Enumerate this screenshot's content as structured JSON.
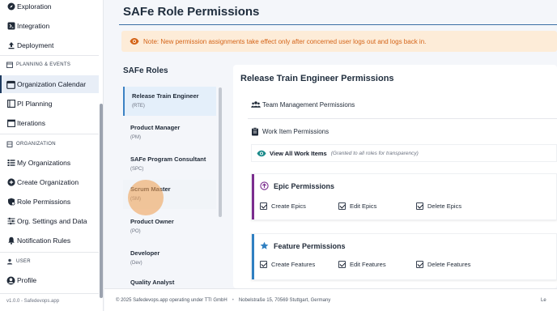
{
  "sidebar": {
    "items_top": [
      {
        "label": "Exploration",
        "icon": "compass-icon"
      },
      {
        "label": "Integration",
        "icon": "integration-icon"
      },
      {
        "label": "Deployment",
        "icon": "upload-icon"
      }
    ],
    "section_planning": "PLANNING & EVENTS",
    "items_planning": [
      {
        "label": "Organization Calendar",
        "icon": "calendar-icon"
      },
      {
        "label": "PI Planning",
        "icon": "pi-planning-icon"
      },
      {
        "label": "Iterations",
        "icon": "iterations-icon"
      }
    ],
    "section_org": "ORGANIZATION",
    "items_org": [
      {
        "label": "My Organizations",
        "icon": "list-icon"
      },
      {
        "label": "Create Organization",
        "icon": "plus-circle-icon"
      },
      {
        "label": "Role Permissions",
        "icon": "shield-icon"
      },
      {
        "label": "Org. Settings and Data",
        "icon": "sliders-icon"
      },
      {
        "label": "Notification Rules",
        "icon": "bell-icon"
      }
    ],
    "section_user": "USER",
    "items_user": [
      {
        "label": "Profile",
        "icon": "person-circle-icon"
      }
    ],
    "version": "v1.0.0 - Safedevops.app"
  },
  "page": {
    "title": "SAFe Role Permissions",
    "note": "Note: New permission assignments take effect only after concerned user logs out and logs back in.",
    "roles_title": "SAFe Roles",
    "roles": [
      {
        "name": "Release Train Engineer",
        "abbr": "(RTE)"
      },
      {
        "name": "Product Manager",
        "abbr": "(PM)"
      },
      {
        "name": "SAFe Program Consultant",
        "abbr": "(SPC)"
      },
      {
        "name": "Scrum Master",
        "abbr": "(SM)"
      },
      {
        "name": "Product Owner",
        "abbr": "(PO)"
      },
      {
        "name": "Developer",
        "abbr": "(Dev)"
      },
      {
        "name": "Quality Analyst",
        "abbr": ""
      }
    ],
    "panel_title": "Release Train Engineer Permissions",
    "team_mgmt": "Team Management Permissions",
    "work_items": "Work Item Permissions",
    "view_all": "View All Work Items",
    "view_all_note": "(Granted to all roles for transparency)",
    "epic": {
      "title": "Epic Permissions",
      "color": "#7b2d8e",
      "options": [
        "Create Epics",
        "Edit Epics",
        "Delete Epics"
      ]
    },
    "feature": {
      "title": "Feature Permissions",
      "color": "#2f7fc1",
      "options": [
        "Create Features",
        "Edit Features",
        "Delete Features"
      ]
    }
  },
  "footer": {
    "copyright": "© 2025 Safedevops.app operating under TTI GmbH",
    "address": "Nobelstraße 15, 70569 Stuttgart, Germany",
    "right": "Le"
  }
}
